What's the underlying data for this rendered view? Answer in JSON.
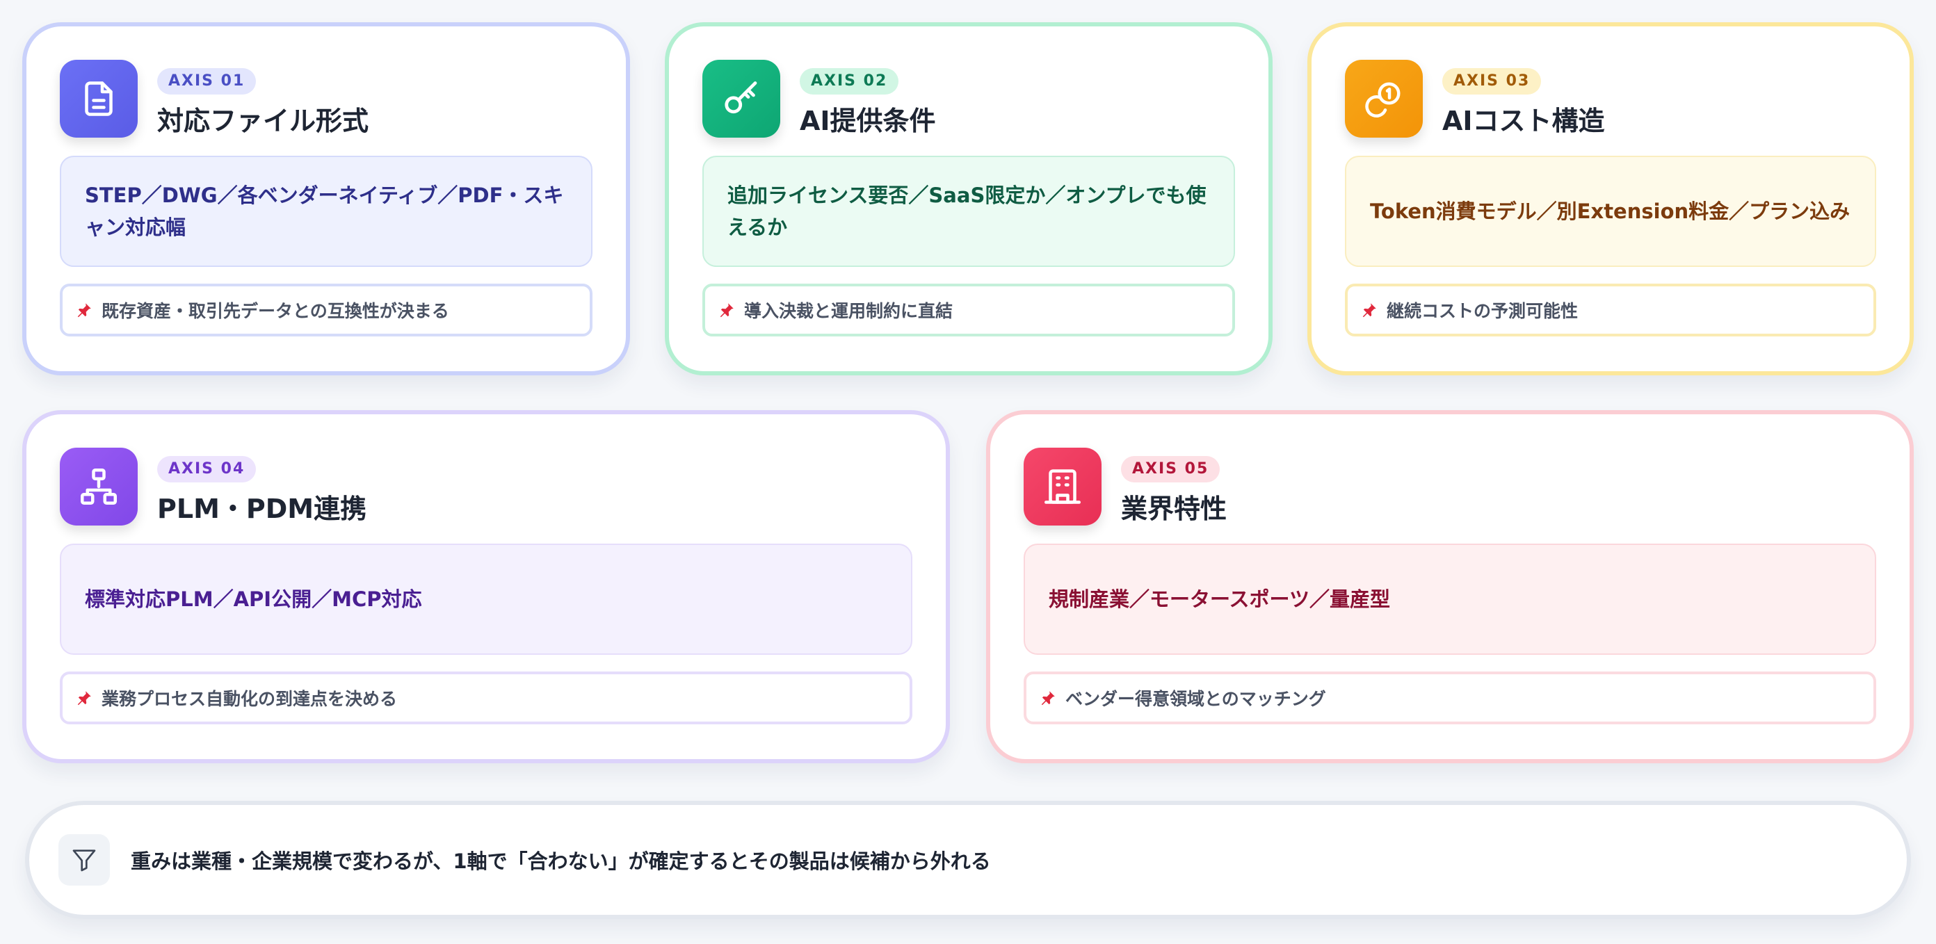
{
  "axes": [
    {
      "badge": "AXIS 01",
      "title": "対応ファイル形式",
      "detail": "STEP／DWG／各ベンダーネイティブ／PDF・スキャン対応幅",
      "note": "既存資産・取引先データとの互換性が決まる",
      "icon": "document-icon",
      "color": "#5f63ef"
    },
    {
      "badge": "AXIS 02",
      "title": "AI提供条件",
      "detail": "追加ライセンス要否／SaaS限定か／オンプレでも使えるか",
      "note": "導入決裁と運用制約に直結",
      "icon": "key-icon",
      "color": "#12b27c"
    },
    {
      "badge": "AXIS 03",
      "title": "AIコスト構造",
      "detail": "Token消費モデル／別Extension料金／プラン込み",
      "note": "継続コストの予測可能性",
      "icon": "coins-icon",
      "color": "#f59e0b"
    },
    {
      "badge": "AXIS 04",
      "title": "PLM・PDM連携",
      "detail": "標準対応PLM／API公開／MCP対応",
      "note": "業務プロセス自動化の到達点を決める",
      "icon": "hierarchy-icon",
      "color": "#8b52ee"
    },
    {
      "badge": "AXIS 05",
      "title": "業界特性",
      "detail": "規制産業／モータースポーツ／量産型",
      "note": "ベンダー得意領域とのマッチング",
      "icon": "building-icon",
      "color": "#ef3a60"
    }
  ],
  "summary": {
    "text": "重みは業種・企業規模で変わるが、1軸で「合わない」が確定するとその製品は候補から外れる",
    "icon": "filter-icon"
  },
  "note_icon": "pin-icon"
}
